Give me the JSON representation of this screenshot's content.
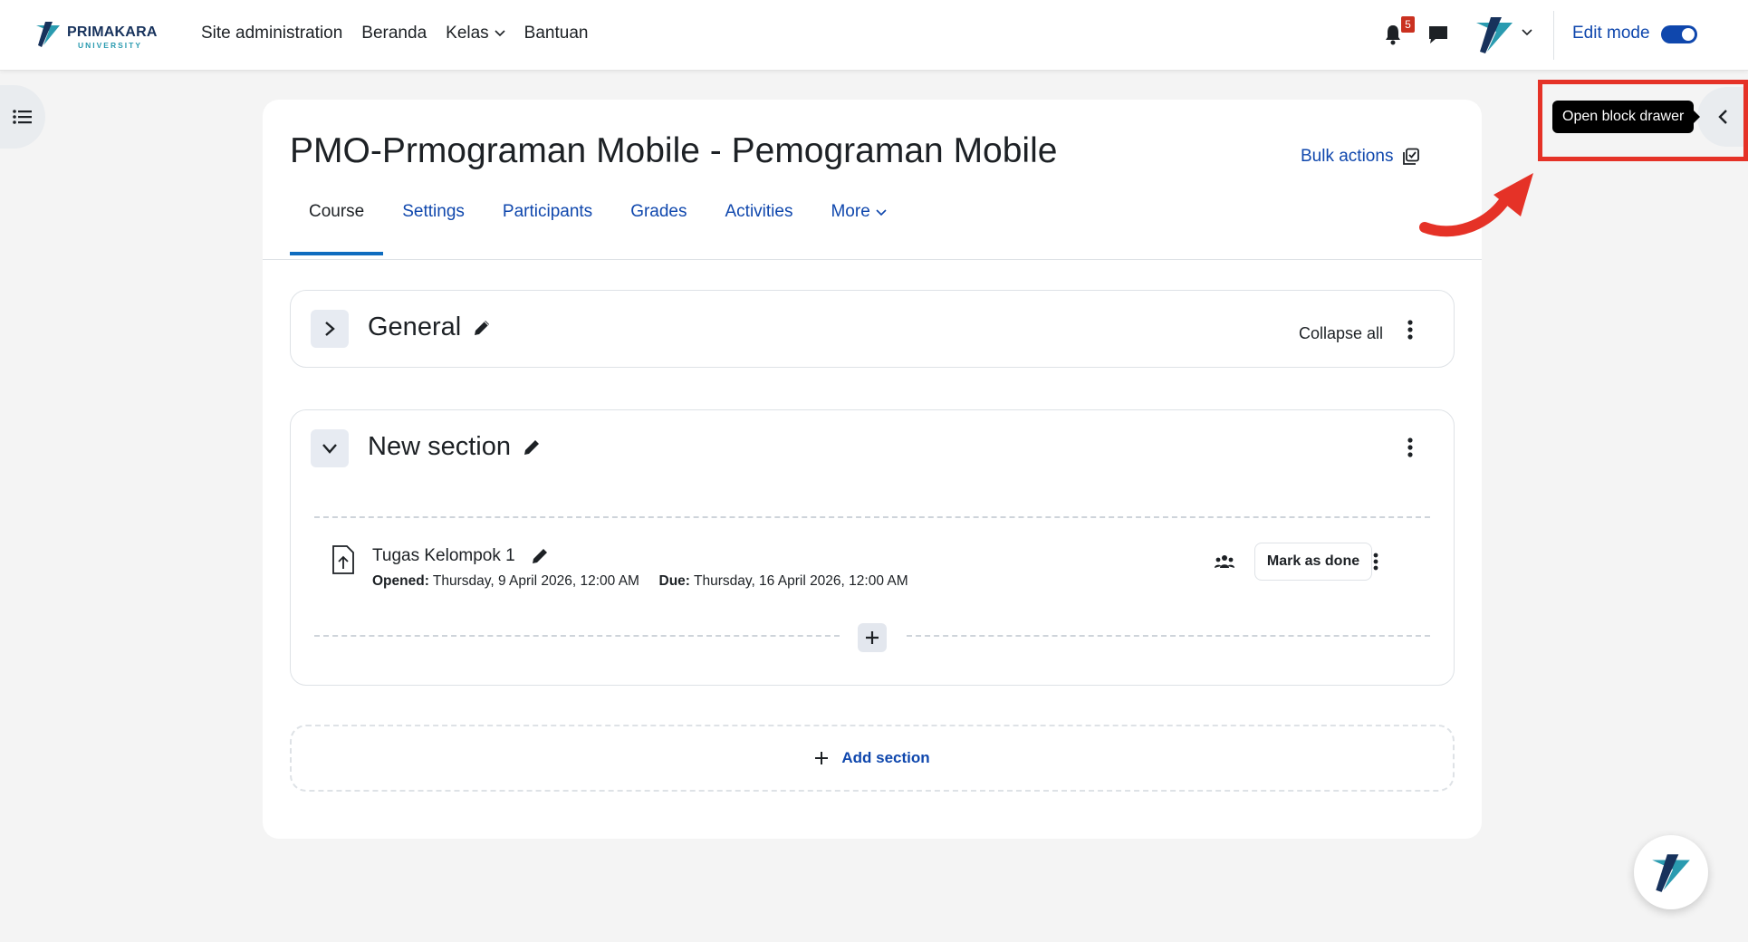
{
  "brand": {
    "name": "PRIMAKARA",
    "sub": "UNIVERSITY",
    "teal": "#2a9bb0",
    "navy": "#17325c"
  },
  "nav": {
    "site_admin": "Site administration",
    "beranda": "Beranda",
    "kelas": "Kelas",
    "bantuan": "Bantuan",
    "notification_count": "5",
    "edit_mode": "Edit mode",
    "edit_mode_on": true
  },
  "course": {
    "title": "PMO-Prmograman Mobile - Pemograman Mobile",
    "bulk_actions": "Bulk actions",
    "tabs": [
      {
        "label": "Course",
        "active": true
      },
      {
        "label": "Settings"
      },
      {
        "label": "Participants"
      },
      {
        "label": "Grades"
      },
      {
        "label": "Activities"
      },
      {
        "label": "More"
      }
    ]
  },
  "sections": {
    "general": {
      "title": "General",
      "collapse_all": "Collapse all"
    },
    "new_section": {
      "title": "New section",
      "activity": {
        "name": "Tugas Kelompok 1",
        "opened_label": "Opened:",
        "opened_value": "Thursday, 9 April 2026, 12:00 AM",
        "due_label": "Due:",
        "due_value": "Thursday, 16 April 2026, 12:00 AM",
        "mark_done": "Mark as done"
      }
    },
    "add_section": "Add section"
  },
  "drawer": {
    "tooltip": "Open block drawer"
  },
  "colors": {
    "link": "#0f47ad",
    "highlight": "#e53227",
    "active_tab": "#0f6cbf"
  }
}
